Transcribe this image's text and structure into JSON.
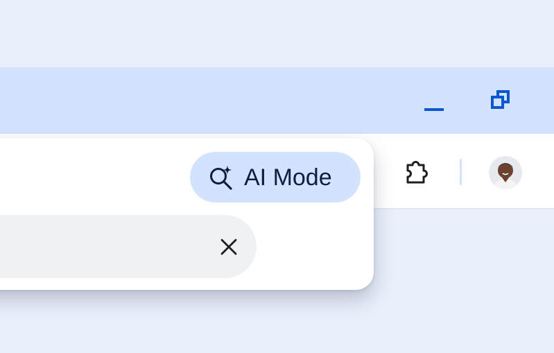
{
  "window_controls": {
    "minimize_icon": "minimize-icon",
    "restore_icon": "restore-icon"
  },
  "toolbar": {
    "extensions_icon": "puzzle-icon",
    "avatar": "profile-avatar"
  },
  "omnibox_popup": {
    "ai_mode_label": "AI Mode",
    "ai_mode_icon": "sparkle-search-icon",
    "search_value": "",
    "clear_icon": "close-icon"
  },
  "colors": {
    "accent": "#0b57d0",
    "titlebar": "#d3e3fd",
    "chip": "#d3e3fd",
    "chip_text": "#0b1f46",
    "page_bg": "#e9effb",
    "field_bg": "#f0f1f2"
  }
}
